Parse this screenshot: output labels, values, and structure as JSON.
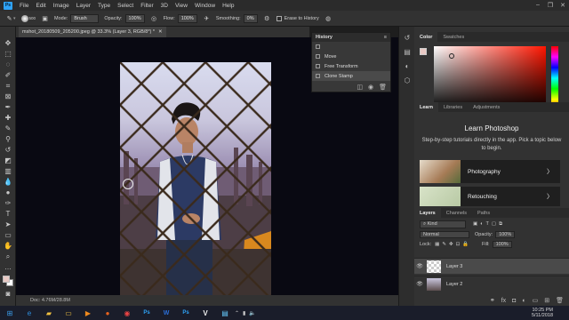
{
  "menubar": {
    "logo": "Ps",
    "items": [
      "File",
      "Edit",
      "Image",
      "Layer",
      "Type",
      "Select",
      "Filter",
      "3D",
      "View",
      "Window",
      "Help"
    ]
  },
  "options": {
    "brush_size": "500",
    "mode_label": "Mode:",
    "mode_value": "Brush",
    "opacity_label": "Opacity:",
    "opacity_value": "100%",
    "flow_label": "Flow:",
    "flow_value": "100%",
    "smoothing_label": "Smoothing:",
    "smoothing_value": "0%",
    "erase_history_label": "Erase to History"
  },
  "document": {
    "tab_title": "mshot_20180509_205200.jpeg @ 33.3% (Layer 3, RGB/8*) *",
    "status": "Doc: 4.76M/28.8M"
  },
  "history": {
    "title": "History",
    "items": [
      "",
      "Move",
      "Free Transform",
      "Clone Stamp"
    ]
  },
  "color_panel": {
    "tabs": [
      "Color",
      "Swatches"
    ],
    "fg_color": "#e8c9c4",
    "bg_color": "#ffffff"
  },
  "learn_panel": {
    "tabs": [
      "Learn",
      "Libraries",
      "Adjustments"
    ],
    "title": "Learn Photoshop",
    "description": "Step-by-step tutorials directly in the app. Pick a topic below to begin.",
    "cards": [
      "Photography",
      "Retouching"
    ]
  },
  "layers_panel": {
    "tabs": [
      "Layers",
      "Channels",
      "Paths"
    ],
    "kind_label": "Kind",
    "blend_mode": "Normal",
    "opacity_label": "Opacity:",
    "opacity_value": "100%",
    "lock_label": "Lock:",
    "fill_label": "Fill:",
    "fill_value": "100%",
    "layers": [
      "Layer 3",
      "Layer 2"
    ]
  },
  "taskbar": {
    "time": "10:25 PM",
    "date": "5/11/2018"
  }
}
